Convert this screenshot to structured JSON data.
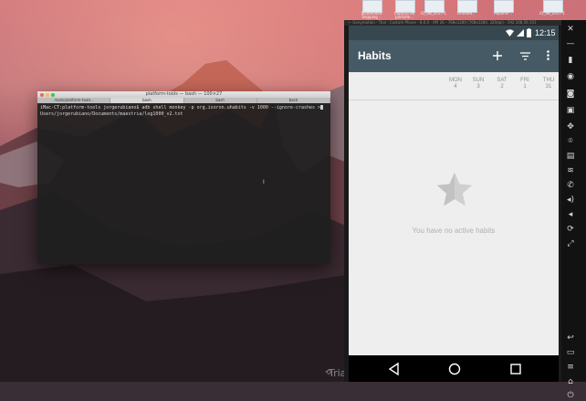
{
  "desktop": {
    "icons": [
      "ScreenShot Snipping ..",
      "Captura de pantalla ..",
      "IO_0B_2017-1",
      "Untitled ..",
      "Reporte ..",
      "IO_0B_2017-1"
    ]
  },
  "terminal": {
    "title": "platform-tools — bash — 100×27",
    "tabs": [
      "..tools/platform-tools ..",
      "bash",
      "bash",
      "bash"
    ],
    "prompt_line": "iMac-CT:platform-tools jorgerubiano$ adb shell monkey -p org.isoron.uhabits -v 1000 --ignore-crashes >",
    "second_line": "Users/jorgerubiano/Documents/maestria/log1000_v2.txt"
  },
  "emulator": {
    "window_title": "— Genymotion - Trial - Custom Phone - 8.0.0 - API 26 - 768x1280 (768x1280, 320dpi) - 192.168.56.101",
    "status_bar": {
      "time": "12:15"
    },
    "app_bar": {
      "title": "Habits"
    },
    "days": [
      {
        "name": "MON",
        "num": "4"
      },
      {
        "name": "SUN",
        "num": "3"
      },
      {
        "name": "SAT",
        "num": "2"
      },
      {
        "name": "FRI",
        "num": "1"
      },
      {
        "name": "THU",
        "num": "31"
      }
    ],
    "empty_message": "You have no active habits",
    "watermark": "Trial"
  },
  "colors": {
    "status_bar": "#37474f",
    "app_bar": "#455a64",
    "content_bg": "#eeeeee",
    "empty_star": "#cfcfcf"
  }
}
